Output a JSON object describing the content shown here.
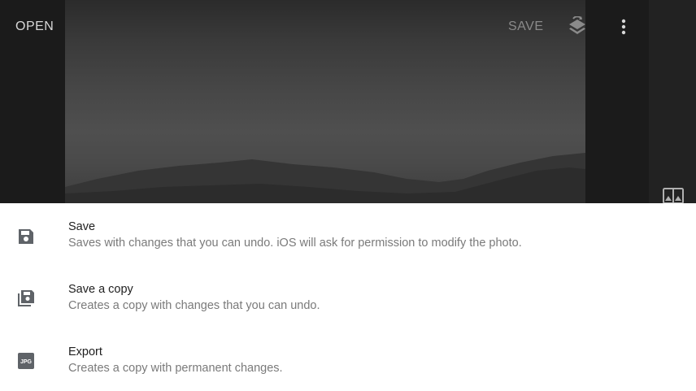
{
  "toolbar": {
    "open_label": "OPEN",
    "save_label": "SAVE",
    "layers_icon": "layers-stack-icon",
    "more_icon": "more-vertical-icon"
  },
  "side_panel": {
    "compare_icon": "compare-image-icon"
  },
  "save_sheet": {
    "options": [
      {
        "title": "Save",
        "description": "Saves with changes that you can undo. iOS will ask for permission to modify the photo.",
        "icon": "floppy-disk-icon"
      },
      {
        "title": "Save a copy",
        "description": "Creates a copy with changes that you can undo.",
        "icon": "copy-save-icon"
      },
      {
        "title": "Export",
        "description": "Creates a copy with permanent changes.",
        "icon": "jpg-export-icon"
      }
    ]
  },
  "colors": {
    "background": "#1b1b1b",
    "sheet": "#ffffff",
    "icon": "#5f6368",
    "title_text": "#202020",
    "secondary_text": "#7a7a7a"
  }
}
